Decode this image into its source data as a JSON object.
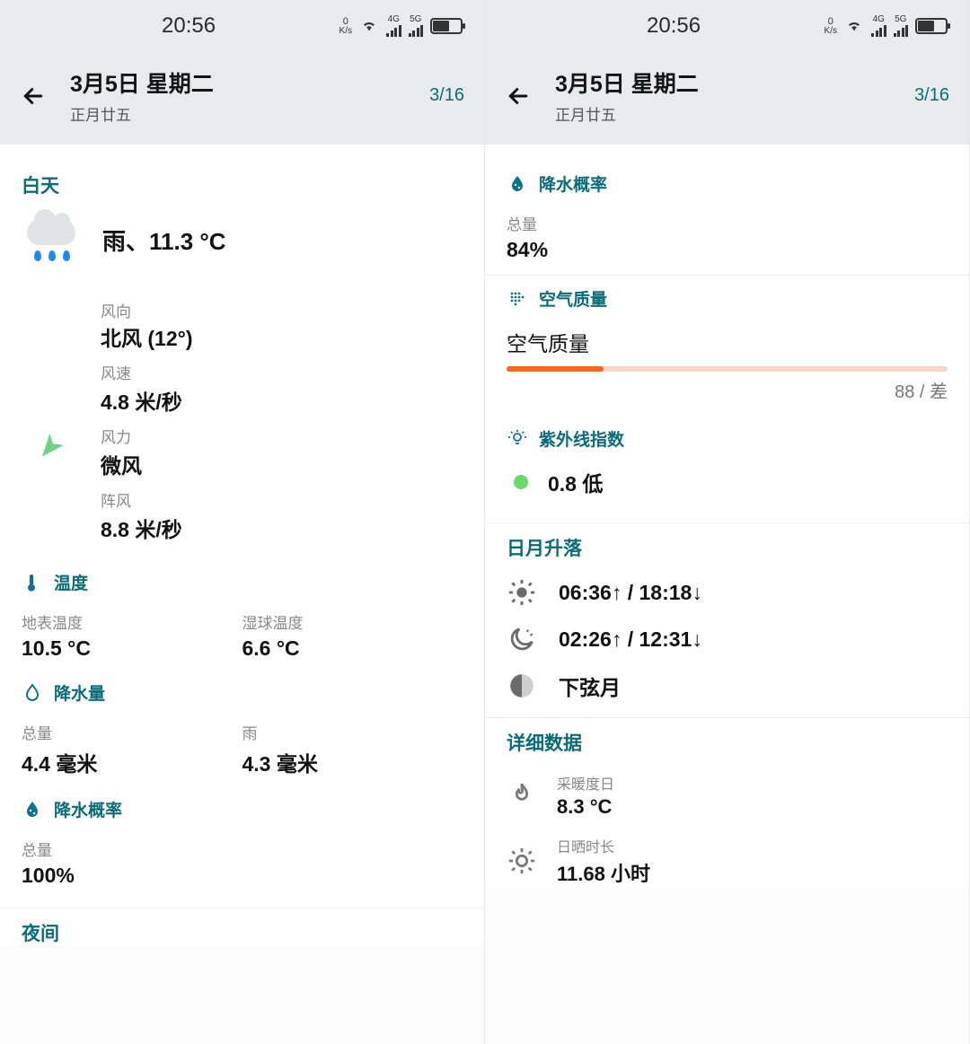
{
  "status": {
    "time": "20:56",
    "net_speed": "0",
    "net_unit": "K/s",
    "sig1_label": "4G",
    "sig2_label": "5G"
  },
  "header": {
    "date": "3月5日 星期二",
    "lunar": "正月廿五",
    "counter": "3/16"
  },
  "left": {
    "day_title": "白天",
    "summary": "雨、11.3 °C",
    "wind_dir_label": "风向",
    "wind_dir_value": "北风 (12°)",
    "wind_speed_label": "风速",
    "wind_speed_value": "4.8 米/秒",
    "wind_force_label": "风力",
    "wind_force_value": "微风",
    "wind_gust_label": "阵风",
    "wind_gust_value": "8.8 米/秒",
    "temp_section": "温度",
    "surface_temp_label": "地表温度",
    "surface_temp_value": "10.5 °C",
    "wetbulb_label": "湿球温度",
    "wetbulb_value": "6.6 °C",
    "precip_amt_section": "降水量",
    "precip_total_label": "总量",
    "precip_total_value": "4.4 毫米",
    "precip_rain_label": "雨",
    "precip_rain_value": "4.3 毫米",
    "precip_prob_section": "降水概率",
    "precip_prob_total_label": "总量",
    "precip_prob_total_value": "100%",
    "night_title": "夜间"
  },
  "right": {
    "precip_prob_section": "降水概率",
    "precip_prob_total_label": "总量",
    "precip_prob_total_value": "84%",
    "aq_section": "空气质量",
    "aq_label": "空气质量",
    "aq_value": "88 / 差",
    "aq_fill_pct": "22%",
    "uv_section": "紫外线指数",
    "uv_value": "0.8 低",
    "sunmoon_title": "日月升落",
    "sun_text": "06:36↑ / 18:18↓",
    "moon_text": "02:26↑ / 12:31↓",
    "moon_phase": "下弦月",
    "detail_title": "详细数据",
    "heating_label": "采暖度日",
    "heating_value": "8.3 °C",
    "sunshine_label": "日晒时长",
    "sunshine_value": "11.68 小时"
  }
}
